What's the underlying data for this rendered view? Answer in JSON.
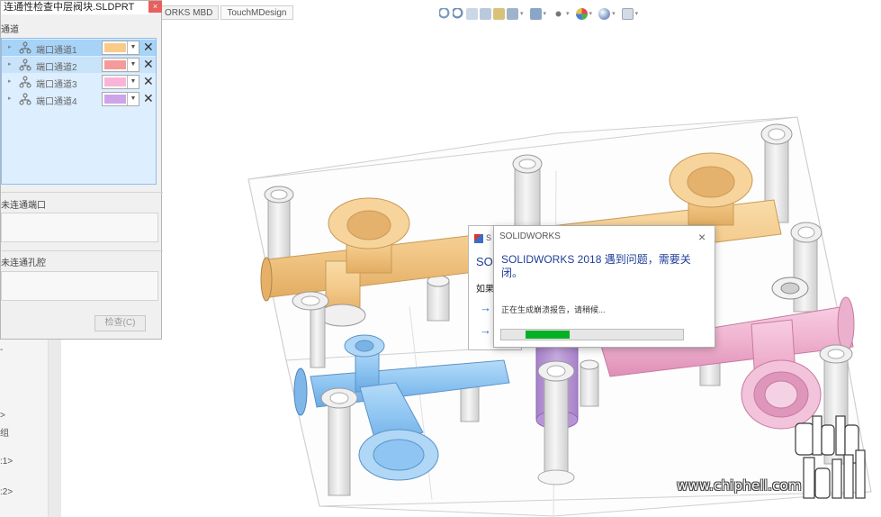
{
  "top_tabs": [
    "ORKS MBD",
    "TouchMDesign"
  ],
  "view_toolbar_icons": [
    "zoom-fit-icon",
    "zoom-area-icon",
    "previous-view-icon",
    "section-view-icon",
    "dynamic-annotation-icon",
    "view-orientation-icon",
    "display-style-icon",
    "hide-show-icon",
    "appearance-icon",
    "scene-icon",
    "view-settings-icon"
  ],
  "panel": {
    "title": "连通性检查中层阀块.SLDPRT",
    "close_label": "×",
    "section_channels": "通道",
    "channels": [
      {
        "label": "端口通道1",
        "color": "#f9cb8a",
        "state": "selected"
      },
      {
        "label": "端口通道2",
        "color": "#f59a9a",
        "state": "hover"
      },
      {
        "label": "端口通道3",
        "color": "#f9b5d8",
        "state": "normal"
      },
      {
        "label": "端口通道4",
        "color": "#cda4ea",
        "state": "normal"
      }
    ],
    "section_ports": "未连通端口",
    "section_holes": "未连通孔腔",
    "check_button": "检查(C)"
  },
  "left_strip": [
    "组",
    ":1>",
    ":2>",
    ">"
  ],
  "dialog_back": {
    "header": "S",
    "title": "SOLI",
    "subtitle": "如果:"
  },
  "dialog": {
    "header": "SOLIDWORKS",
    "title": "SOLIDWORKS 2018 遇到问题，需要关闭。",
    "message": "正在生成崩溃报告，请稍候...",
    "progress": 0.24,
    "close_label": "×"
  },
  "watermark": {
    "url": "www.chiphell.com",
    "logo": "chiphell"
  },
  "model_colors": {
    "orange": "#f3c98a",
    "blue": "#8ec5f2",
    "purple": "#bd9fd8",
    "pink": "#efb1cf",
    "gray": "#e8e8e8"
  }
}
